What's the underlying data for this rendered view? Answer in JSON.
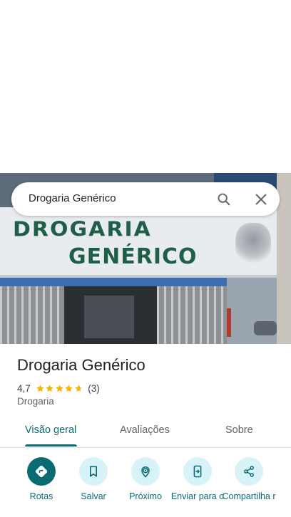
{
  "search": {
    "query": "Drogaria Genérico"
  },
  "photo": {
    "sign_line1": "DROGARIA",
    "sign_line2": "GENÉRICO"
  },
  "place": {
    "name": "Drogaria Genérico",
    "rating": "4,7",
    "rating_stars": 4.7,
    "review_count": "(3)",
    "category": "Drogaria"
  },
  "tabs": [
    {
      "label": "Visão geral",
      "active": true
    },
    {
      "label": "Avaliações",
      "active": false
    },
    {
      "label": "Sobre",
      "active": false
    }
  ],
  "actions": [
    {
      "label": "Rotas",
      "icon": "directions-icon"
    },
    {
      "label": "Salvar",
      "icon": "bookmark-icon"
    },
    {
      "label": "Próximo",
      "icon": "nearby-icon"
    },
    {
      "label": "Enviar para o",
      "icon": "send-to-phone-icon"
    },
    {
      "label": "Compartilha r",
      "icon": "share-icon"
    }
  ],
  "colors": {
    "accent": "#0b6b73",
    "action_bg": "#d7f3f7",
    "star": "#f4b400"
  }
}
